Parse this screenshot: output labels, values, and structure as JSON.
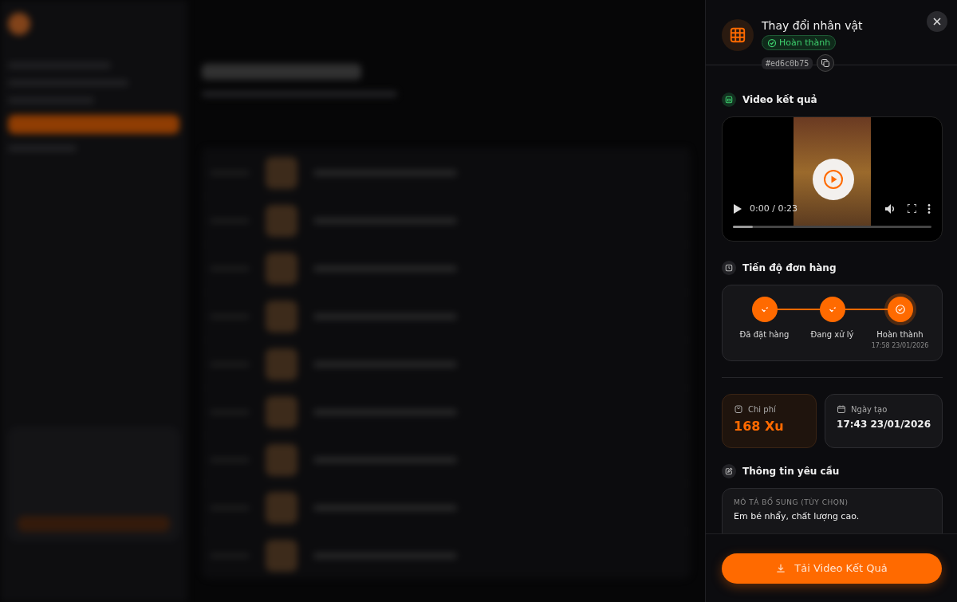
{
  "drawer": {
    "title": "Thay đổi nhân vật",
    "status": "Hoàn thành",
    "order_id": "#ed6c0b75"
  },
  "video": {
    "heading": "Video kết quả",
    "time": "0:00 / 0:23"
  },
  "progress": {
    "heading": "Tiến độ đơn hàng",
    "steps": [
      {
        "label": "Đã đặt hàng",
        "current": false
      },
      {
        "label": "Đang xử lý",
        "current": false
      },
      {
        "label": "Hoàn thành",
        "time": "17:58 23/01/2026",
        "current": true
      }
    ]
  },
  "stats": [
    {
      "kind": "cost",
      "label": "Chi phí",
      "value": "168 Xu"
    },
    {
      "kind": "date",
      "label": "Ngày tạo",
      "value": "17:43 23/01/2026"
    }
  ],
  "request": {
    "heading": "Thông tin yêu cầu",
    "field_label": "MÔ TẢ BỔ SUNG (TÙY CHỌN)",
    "field_value": "Em bé nhẩy, chất lượng cao."
  },
  "download_button": "Tải Video Kết Quả"
}
